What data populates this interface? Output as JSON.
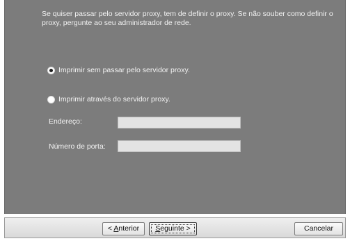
{
  "intro": {
    "text": "Se quiser passar pelo servidor proxy, tem de definir o proxy. Se não souber como definir o proxy, pergunte ao seu administrador de rede."
  },
  "options": {
    "no_proxy": {
      "label": "Imprimir sem passar pelo servidor proxy.",
      "selected": true
    },
    "use_proxy": {
      "label": "Imprimir através do servidor proxy.",
      "selected": false
    }
  },
  "fields": {
    "address": {
      "label": "Endereço:",
      "value": ""
    },
    "port": {
      "label": "Número de porta:",
      "value": ""
    }
  },
  "buttons": {
    "back": {
      "label_prefix": "< ",
      "label_mnemonic": "A",
      "label_rest": "nterior"
    },
    "next": {
      "label_mnemonic": "S",
      "label_rest": "eguinte",
      "label_suffix": " >"
    },
    "cancel": {
      "label": "Cancelar"
    }
  },
  "colors": {
    "panel_background": "#7c7c7c",
    "panel_text": "#f2f2f2",
    "input_background": "#e3e3e3",
    "button_bar_background": "#e6e6e6"
  }
}
